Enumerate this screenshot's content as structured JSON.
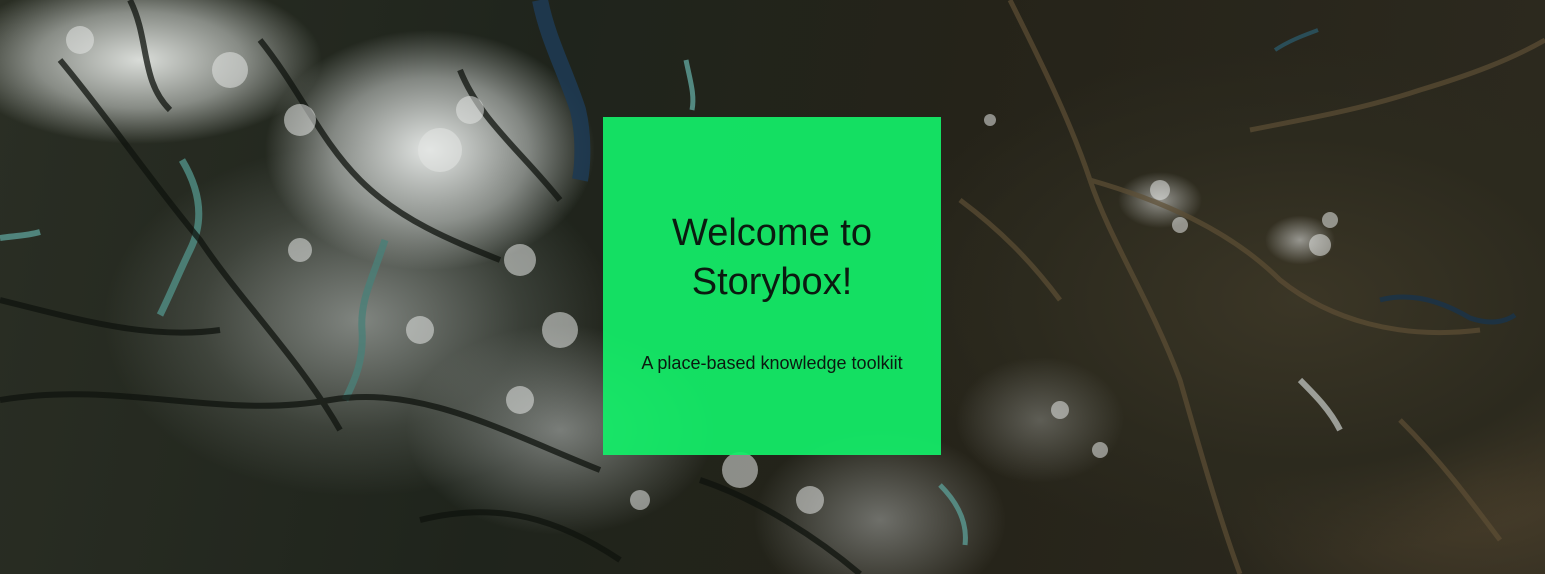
{
  "hero": {
    "background": "satellite-terrain-map"
  },
  "welcome_card": {
    "title": "Welcome to Storybox!",
    "subtitle": "A place-based knowledge toolkiit",
    "accent_color": "#13ee68"
  }
}
